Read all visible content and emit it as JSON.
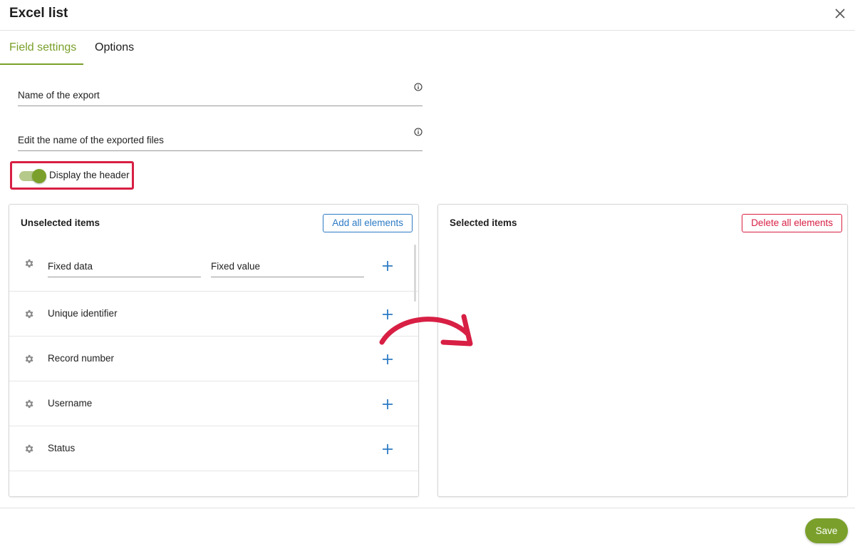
{
  "dialog": {
    "title": "Excel list"
  },
  "tabs": [
    {
      "label": "Field settings",
      "active": true
    },
    {
      "label": "Options",
      "active": false
    }
  ],
  "fields": {
    "export_name": {
      "label": "Name of the export"
    },
    "file_name": {
      "label": "Edit the name of the exported files"
    }
  },
  "toggle": {
    "label": "Display the header",
    "on": true
  },
  "unselected": {
    "title": "Unselected items",
    "add_all": "Add all elements",
    "fixed_row": {
      "input1": "Fixed data",
      "input2": "Fixed value"
    },
    "items": [
      {
        "label": "Unique identifier"
      },
      {
        "label": "Record number"
      },
      {
        "label": "Username"
      },
      {
        "label": "Status"
      }
    ]
  },
  "selected": {
    "title": "Selected items",
    "delete_all": "Delete all elements"
  },
  "footer": {
    "save": "Save"
  },
  "colors": {
    "accent_green": "#7aa02b",
    "action_blue": "#2d7bc4",
    "highlight_red": "#d81f44"
  },
  "icons": [
    "close-icon",
    "info-icon",
    "gear-icon",
    "plus-icon",
    "curved-arrow-icon"
  ]
}
